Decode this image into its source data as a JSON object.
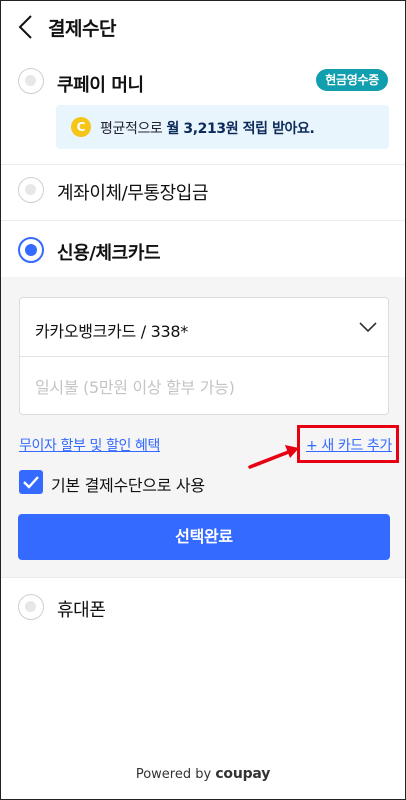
{
  "header": {
    "title": "결제수단"
  },
  "options": {
    "coupay_money": {
      "label": "쿠페이 머니",
      "badge": "현금영수증"
    },
    "coupay_promo": {
      "coin": "C",
      "prefix": "평균적으로 ",
      "highlight": "월 3,213원 적립 받아요."
    },
    "bank_transfer": {
      "label": "계좌이체/무통장입금"
    },
    "credit_card": {
      "label": "신용/체크카드",
      "selected": true
    },
    "phone": {
      "label": "휴대폰"
    }
  },
  "card_panel": {
    "card_select_value": "카카오뱅크카드 / 338*",
    "installment_placeholder": "일시불 (5만원 이상 할부 가능)",
    "benefits_link": "무이자 할부 및 할인 혜택",
    "add_card_link": "+ 새 카드 추가",
    "default_checkbox_label": "기본 결제수단으로 사용",
    "default_checked": true,
    "confirm_button": "선택완료"
  },
  "footer": {
    "powered_by": "Powered by",
    "brand": "coupay"
  },
  "colors": {
    "accent": "#346aff",
    "badge": "#119eae",
    "annotation": "#e60012"
  }
}
